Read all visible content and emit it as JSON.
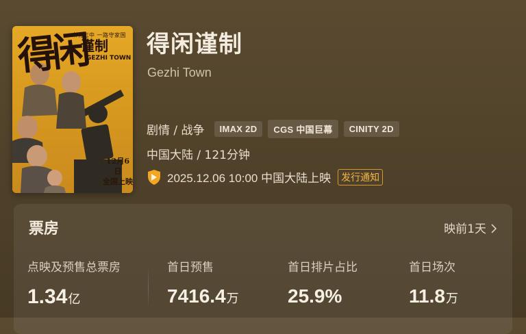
{
  "movie": {
    "title": "得闲谨制",
    "title_en": "Gezhi Town",
    "genre": "剧情 / 战争",
    "formats": [
      "IMAX 2D",
      "CGS 中国巨幕",
      "CINITY 2D"
    ],
    "region_duration": "中国大陆 / 121分钟",
    "release_datetime": "2025.12.06 10:00",
    "release_region": "中国大陆上映",
    "notice_badge": "发行通知"
  },
  "poster": {
    "tagline": "一众有志中  一路守家国",
    "title_main": "得闲",
    "title_sub": "谨制",
    "title_en": "GEZHI TOWN",
    "date_line1": "12月6日",
    "date_line2": "全国上映"
  },
  "box_office": {
    "title": "票房",
    "days_label": "映前1天",
    "stats": [
      {
        "label": "点映及预售总票房",
        "value": "1.34",
        "unit": "亿"
      },
      {
        "label": "首日预售",
        "value": "7416.4",
        "unit": "万"
      },
      {
        "label": "首日排片占比",
        "value": "25.9%",
        "unit": ""
      },
      {
        "label": "首日场次",
        "value": "11.8",
        "unit": "万"
      }
    ]
  },
  "colors": {
    "background": "#54452d",
    "accent": "#f4b544",
    "shield": "#f2a623"
  }
}
